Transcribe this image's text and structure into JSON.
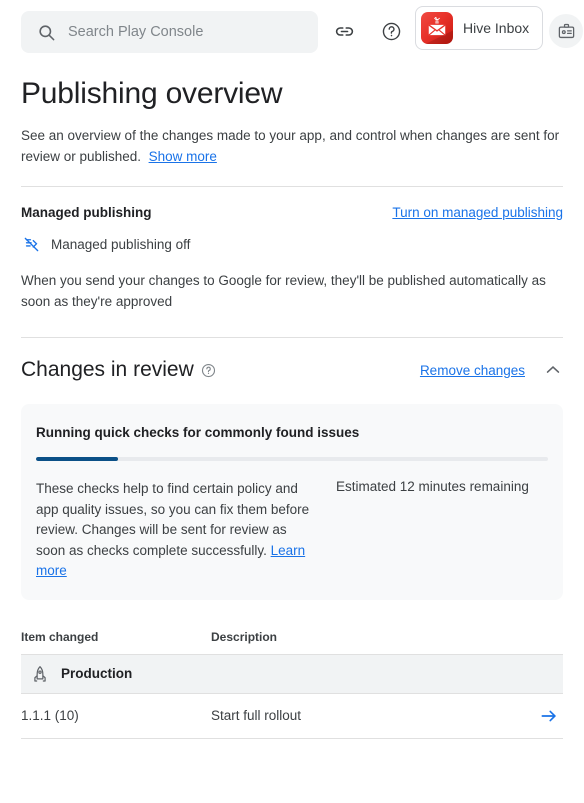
{
  "header": {
    "search": {
      "placeholder": "Search Play Console",
      "value": "",
      "icon": "search-icon"
    },
    "link_icon": "link-icon",
    "help_icon": "help-circle-icon",
    "hive_chip": {
      "label": "Hive Inbox",
      "icon": "hive-envelope-icon",
      "color": "#e8322a"
    },
    "badge_icon": "id-badge-icon"
  },
  "page": {
    "title": "Publishing overview",
    "description_part1": "See an overview of the changes made to your app, and control when changes are sent for review or published.",
    "show_more_link": "Show more"
  },
  "managed_publishing": {
    "label": "Managed publishing",
    "action_link": "Turn on managed publishing",
    "status_icon": "unpublished-off-icon",
    "status_text": "Managed publishing off",
    "body": "When you send your changes to Google for review, they'll be published automatically as soon as they're approved"
  },
  "changes_in_review": {
    "title": "Changes in review",
    "help_icon": "help-circle-icon",
    "remove_link": "Remove changes",
    "collapse_icon": "chevron-up-icon",
    "card": {
      "title": "Running quick checks for commonly found issues",
      "progress_percent": 16,
      "progress_color": "#0b5087",
      "body_text": "These checks help to find certain policy and app quality issues, so you can fix them before review. Changes will be sent for review as soon as checks complete successfully.",
      "learn_more_link": "Learn more",
      "estimate": "Estimated 12 minutes remaining"
    },
    "table": {
      "columns": [
        "Item changed",
        "Description"
      ],
      "groups": [
        {
          "icon": "rocket-icon",
          "label": "Production",
          "rows": [
            {
              "item": "1.1.1 (10)",
              "description": "Start full rollout",
              "action_icon": "arrow-right-icon"
            }
          ]
        }
      ]
    }
  }
}
